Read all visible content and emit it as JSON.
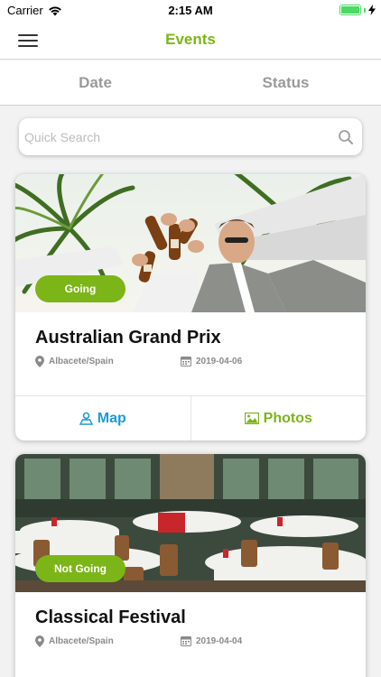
{
  "status_bar": {
    "carrier": "Carrier",
    "time": "2:15 AM"
  },
  "nav": {
    "title": "Events"
  },
  "tabs": [
    {
      "label": "Date"
    },
    {
      "label": "Status"
    }
  ],
  "search": {
    "placeholder": "Quick Search",
    "value": ""
  },
  "events": [
    {
      "title": "Australian Grand Prix",
      "status": "Going",
      "location": "Albacete/Spain",
      "date": "2019-04-06",
      "actions": {
        "map": "Map",
        "photos": "Photos"
      }
    },
    {
      "title": "Classical Festival",
      "status": "Not Going",
      "location": "Albacete/Spain",
      "date": "2019-04-04"
    }
  ],
  "colors": {
    "accent": "#7cb518",
    "map_blue": "#1c9ad6",
    "tab_inactive": "#9a9a9a"
  },
  "icons": [
    "menu-icon",
    "wifi-icon",
    "battery-icon",
    "search-icon",
    "location-pin-icon",
    "calendar-icon",
    "map-icon",
    "photo-icon"
  ]
}
